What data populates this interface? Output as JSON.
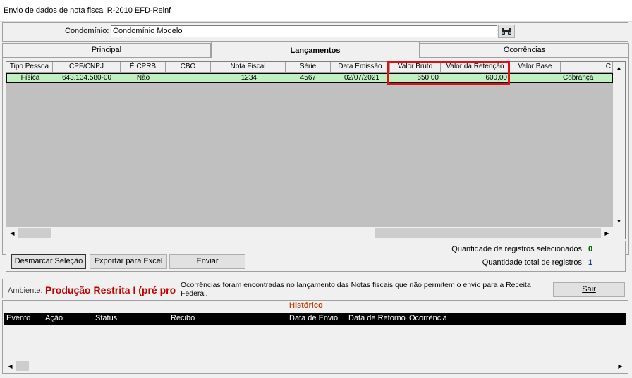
{
  "window": {
    "title": "Envio de dados de nota fiscal R-2010 EFD-Reinf"
  },
  "condominio": {
    "label": "Condomínio:",
    "value": "Condomínio Modelo",
    "search_icon": "binoculars-icon"
  },
  "tabs": [
    {
      "label": "Principal",
      "active": false
    },
    {
      "label": "Lançamentos",
      "active": true
    },
    {
      "label": "Ocorrências",
      "active": false
    }
  ],
  "grid": {
    "columns": [
      "Tipo Pessoa",
      "CPF/CNPJ",
      "É CPRB",
      "CBO",
      "Nota Fiscal",
      "Série",
      "Data Emissão",
      "Valor Bruto",
      "Valor da Retenção",
      "Valor Base",
      "C"
    ],
    "rows": [
      {
        "tipo": "Física",
        "cpf": "643.134.580-00",
        "cprb": "Não",
        "cbo": "",
        "nota": "1234",
        "serie": "4567",
        "data": "02/07/2021",
        "bruto": "650,00",
        "retencao": "600,00",
        "base": "",
        "c": "Cobrança"
      }
    ],
    "highlight_color": "#e01010",
    "row_color": "#c0f0c0"
  },
  "actions": {
    "desmarcar": "Desmarcar Seleção",
    "exportar": "Exportar para Excel",
    "enviar": "Enviar"
  },
  "counts": {
    "selected_label": "Quantidade de registros selecionados:",
    "selected_value": "0",
    "total_label": "Quantidade total de registros:",
    "total_value": "1"
  },
  "ambiente": {
    "label": "Ambiente:",
    "value": "Produção Restrita I (pré pro",
    "message": "Ocorrências foram encontradas no lançamento das Notas fiscais que não permitem o envio para a  Receita Federal.",
    "sair": "Sair"
  },
  "historico": {
    "title": "Histórico",
    "columns": [
      "Evento",
      "Ação",
      "Status",
      "Recibo",
      "Data de Envio",
      "Data de Retorno",
      "Ocorrência"
    ]
  }
}
